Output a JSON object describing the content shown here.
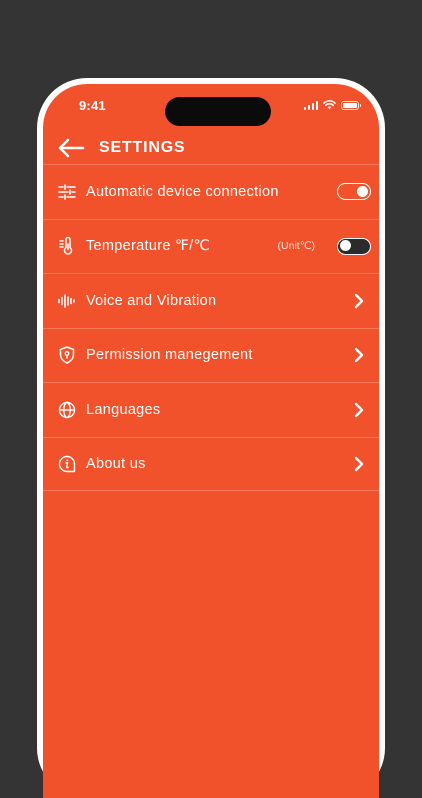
{
  "status_bar": {
    "time": "9:41"
  },
  "header": {
    "title": "SETTINGS"
  },
  "settings": [
    {
      "label": "Automatic device connection",
      "control": "toggle",
      "state": "on",
      "icon": "sliders-icon"
    },
    {
      "label": "Temperature ℉/℃",
      "control": "toggle",
      "state": "off",
      "unit_hint": "(Unit℃)",
      "icon": "thermometer-icon"
    },
    {
      "label": "Voice and Vibration",
      "control": "chevron",
      "icon": "sound-wave-icon"
    },
    {
      "label": "Permission manegement",
      "control": "chevron",
      "icon": "shield-icon"
    },
    {
      "label": "Languages",
      "control": "chevron",
      "icon": "globe-icon"
    },
    {
      "label": "About us",
      "control": "chevron",
      "icon": "info-icon"
    }
  ],
  "colors": {
    "background": "#353434",
    "accent": "#f1522b",
    "phone_frame": "#ffffff"
  }
}
